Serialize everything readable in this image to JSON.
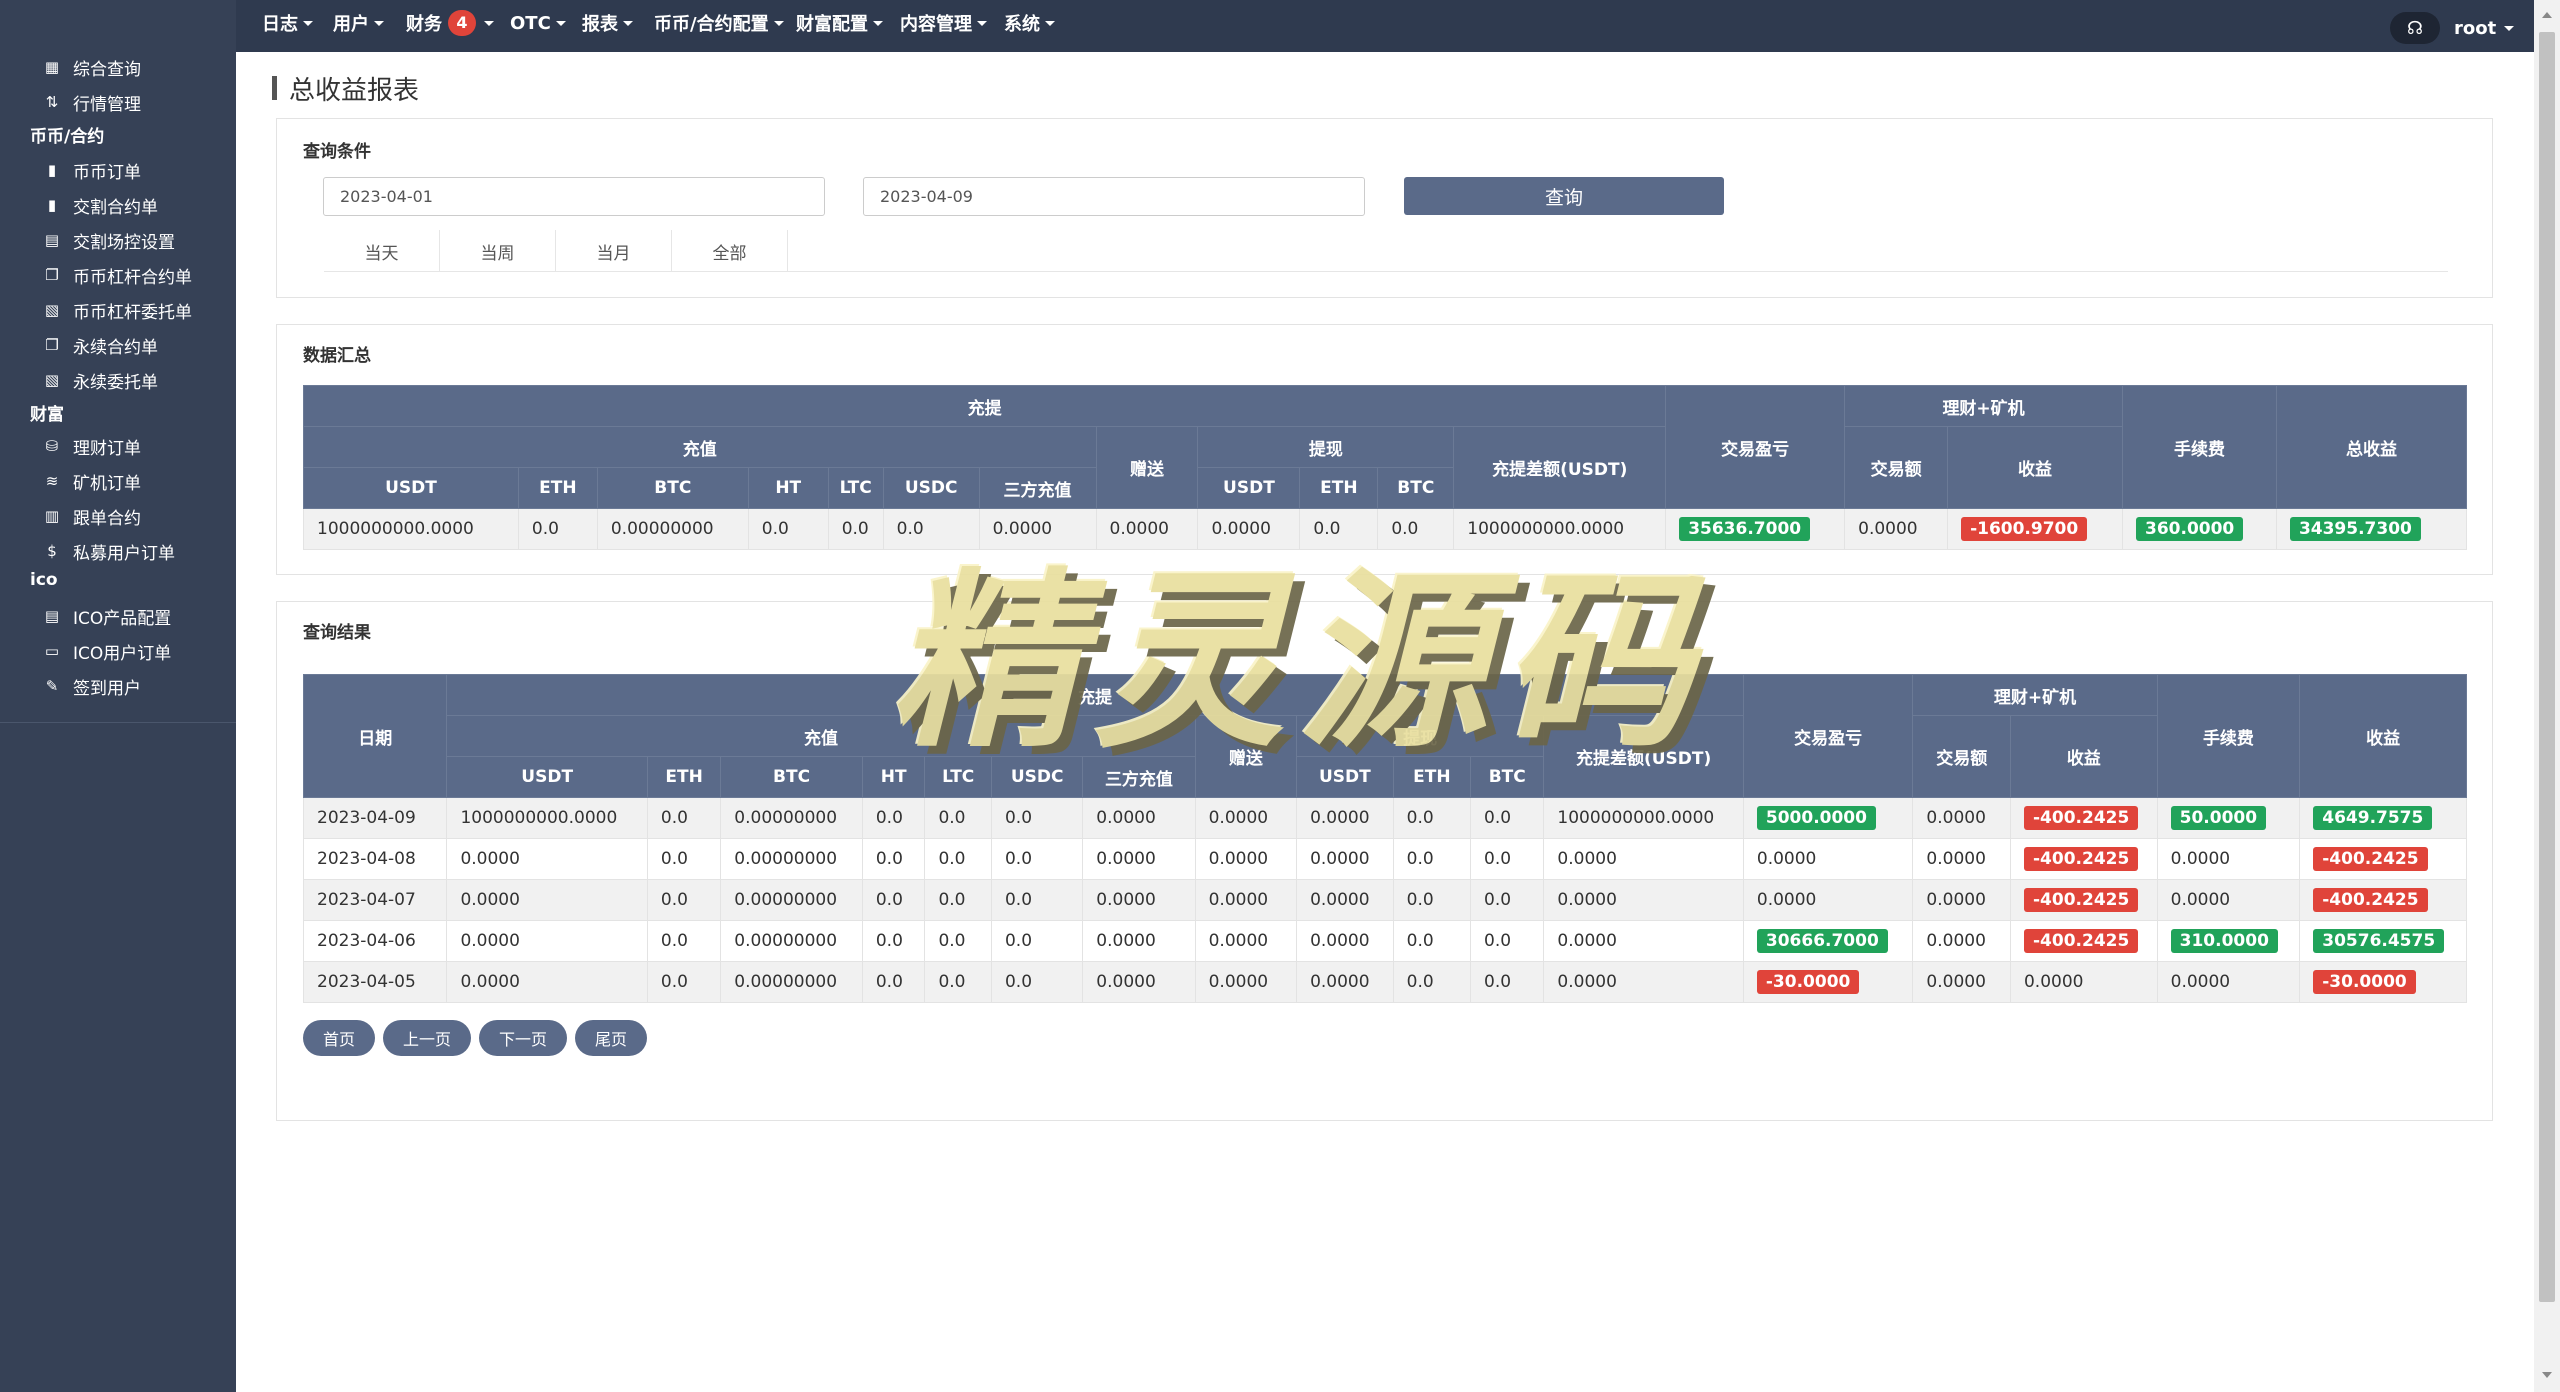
{
  "topnav": [
    {
      "label": "日志"
    },
    {
      "label": "用户"
    },
    {
      "label": "财务",
      "badge": "4"
    },
    {
      "label": "OTC"
    },
    {
      "label": "报表"
    },
    {
      "label": "币币/合约配置"
    },
    {
      "label": "财富配置"
    },
    {
      "label": "内容管理"
    },
    {
      "label": "系统"
    }
  ],
  "user": {
    "name": "root"
  },
  "sidebar": {
    "items": [
      {
        "label": "综合查询",
        "icon": "dashboard-icon"
      },
      {
        "label": "行情管理",
        "icon": "sort-icon"
      },
      {
        "label": "币币订单",
        "icon": "bookmark-icon"
      },
      {
        "label": "交割合约单",
        "icon": "bookmark-icon"
      },
      {
        "label": "交割场控设置",
        "icon": "file-icon"
      },
      {
        "label": "币币杠杆合约单",
        "icon": "copy-icon"
      },
      {
        "label": "币币杠杆委托单",
        "icon": "file-gear-icon"
      },
      {
        "label": "永续合约单",
        "icon": "copy-icon"
      },
      {
        "label": "永续委托单",
        "icon": "file-gear-icon"
      },
      {
        "label": "理财订单",
        "icon": "database-icon"
      },
      {
        "label": "矿机订单",
        "icon": "layers-icon"
      },
      {
        "label": "跟单合约",
        "icon": "book-icon"
      },
      {
        "label": "私募用户订单",
        "icon": "dollar-icon"
      },
      {
        "label": "ICO产品配置",
        "icon": "file-text-icon"
      },
      {
        "label": "ICO用户订单",
        "icon": "comment-icon"
      },
      {
        "label": "签到用户",
        "icon": "edit-icon"
      }
    ],
    "groups": [
      {
        "label": "币币/合约"
      },
      {
        "label": "财富"
      },
      {
        "label": "ico"
      }
    ]
  },
  "page": {
    "title": "总收益报表"
  },
  "query": {
    "title": "查询条件",
    "start_date": "2023-04-01",
    "end_date": "2023-04-09",
    "button": "查询",
    "quick": [
      "当天",
      "当周",
      "当月",
      "全部"
    ]
  },
  "summary": {
    "title": "数据汇总",
    "headers": {
      "chongti": "充提",
      "chongzhi": "充值",
      "zengsong": "赠送",
      "tixian": "提现",
      "diff": "充提差额(USDT)",
      "trade_pl": "交易盈亏",
      "licai": "理财+矿机",
      "trade_amt": "交易额",
      "income": "收益",
      "fee": "手续费",
      "total": "总收益",
      "sub_recharge": [
        "USDT",
        "ETH",
        "BTC",
        "HT",
        "LTC",
        "USDC",
        "三方充值"
      ],
      "sub_withdraw": [
        "USDT",
        "ETH",
        "BTC"
      ]
    },
    "row": {
      "recharge": [
        "1000000000.0000",
        "0.0",
        "0.00000000",
        "0.0",
        "0.0",
        "0.0",
        "0.0000"
      ],
      "gift": "0.0000",
      "withdraw": [
        "0.0000",
        "0.0",
        "0.0"
      ],
      "diff": "1000000000.0000",
      "trade_pl": "35636.7000",
      "trade_amt": "0.0000",
      "income": "-1600.9700",
      "fee": "360.0000",
      "total": "34395.7300"
    }
  },
  "results": {
    "title": "查询结果",
    "headers": {
      "date": "日期",
      "chongti": "充提",
      "chongzhi": "充值",
      "zengsong": "赠送",
      "tixian": "提现",
      "diff": "充提差额(USDT)",
      "trade_pl": "交易盈亏",
      "licai": "理财+矿机",
      "trade_amt": "交易额",
      "income": "收益",
      "fee": "手续费",
      "profit": "收益",
      "sub_recharge": [
        "USDT",
        "ETH",
        "BTC",
        "HT",
        "LTC",
        "USDC",
        "三方充值"
      ],
      "sub_withdraw": [
        "USDT",
        "ETH",
        "BTC"
      ]
    },
    "rows": [
      {
        "date": "2023-04-09",
        "recharge": [
          "1000000000.0000",
          "0.0",
          "0.00000000",
          "0.0",
          "0.0",
          "0.0",
          "0.0000"
        ],
        "gift": "0.0000",
        "withdraw": [
          "0.0000",
          "0.0",
          "0.0"
        ],
        "diff": "1000000000.0000",
        "trade_pl": "5000.0000",
        "trade_pl_tag": "g",
        "trade_amt": "0.0000",
        "income": "-400.2425",
        "income_tag": "r",
        "fee": "50.0000",
        "fee_tag": "g",
        "profit": "4649.7575",
        "profit_tag": "g"
      },
      {
        "date": "2023-04-08",
        "recharge": [
          "0.0000",
          "0.0",
          "0.00000000",
          "0.0",
          "0.0",
          "0.0",
          "0.0000"
        ],
        "gift": "0.0000",
        "withdraw": [
          "0.0000",
          "0.0",
          "0.0"
        ],
        "diff": "0.0000",
        "trade_pl": "0.0000",
        "trade_pl_tag": "",
        "trade_amt": "0.0000",
        "income": "-400.2425",
        "income_tag": "r",
        "fee": "0.0000",
        "fee_tag": "",
        "profit": "-400.2425",
        "profit_tag": "r"
      },
      {
        "date": "2023-04-07",
        "recharge": [
          "0.0000",
          "0.0",
          "0.00000000",
          "0.0",
          "0.0",
          "0.0",
          "0.0000"
        ],
        "gift": "0.0000",
        "withdraw": [
          "0.0000",
          "0.0",
          "0.0"
        ],
        "diff": "0.0000",
        "trade_pl": "0.0000",
        "trade_pl_tag": "",
        "trade_amt": "0.0000",
        "income": "-400.2425",
        "income_tag": "r",
        "fee": "0.0000",
        "fee_tag": "",
        "profit": "-400.2425",
        "profit_tag": "r"
      },
      {
        "date": "2023-04-06",
        "recharge": [
          "0.0000",
          "0.0",
          "0.00000000",
          "0.0",
          "0.0",
          "0.0",
          "0.0000"
        ],
        "gift": "0.0000",
        "withdraw": [
          "0.0000",
          "0.0",
          "0.0"
        ],
        "diff": "0.0000",
        "trade_pl": "30666.7000",
        "trade_pl_tag": "g",
        "trade_amt": "0.0000",
        "income": "-400.2425",
        "income_tag": "r",
        "fee": "310.0000",
        "fee_tag": "g",
        "profit": "30576.4575",
        "profit_tag": "g"
      },
      {
        "date": "2023-04-05",
        "recharge": [
          "0.0000",
          "0.0",
          "0.00000000",
          "0.0",
          "0.0",
          "0.0",
          "0.0000"
        ],
        "gift": "0.0000",
        "withdraw": [
          "0.0000",
          "0.0",
          "0.0"
        ],
        "diff": "0.0000",
        "trade_pl": "-30.0000",
        "trade_pl_tag": "r",
        "trade_amt": "0.0000",
        "income": "0.0000",
        "income_tag": "",
        "fee": "0.0000",
        "fee_tag": "",
        "profit": "-30.0000",
        "profit_tag": "r"
      }
    ]
  },
  "pager": {
    "first": "首页",
    "prev": "上一页",
    "next": "下一页",
    "last": "尾页"
  },
  "watermark": {
    "text": "精灵源码"
  },
  "colors": {
    "sidebar": "#364156",
    "topbar": "#2f3a4f",
    "header": "#5a6a89",
    "green": "#21a35a",
    "red": "#e0443a"
  }
}
